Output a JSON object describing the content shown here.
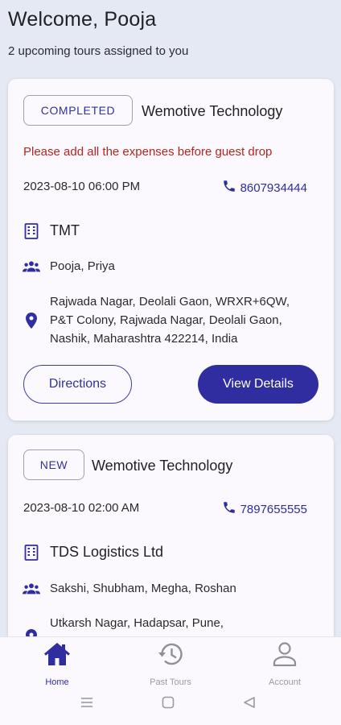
{
  "header": {
    "welcome": "Welcome, Pooja",
    "subtitle": "2 upcoming tours assigned to you"
  },
  "tours": [
    {
      "status": "COMPLETED",
      "company": "Wemotive Technology",
      "alert": "Please add all the expenses before guest drop",
      "datetime": "2023-08-10 06:00 PM",
      "phone": "8607934444",
      "organization": "TMT",
      "guests": "Pooja, Priya",
      "address": "Rajwada Nagar, Deolali Gaon, WRXR+6QW, P&T Colony, Rajwada Nagar, Deolali Gaon, Nashik, Maharashtra 422214, India",
      "directions_label": "Directions",
      "view_details_label": "View Details"
    },
    {
      "status": "NEW",
      "company": "Wemotive Technology",
      "datetime": "2023-08-10 02:00 AM",
      "phone": "7897655555",
      "organization": "TDS Logistics Ltd",
      "guests": "Sakshi, Shubham, Megha, Roshan",
      "address": "Utkarsh Nagar, Hadapsar, Pune,"
    }
  ],
  "nav": {
    "home": "Home",
    "past_tours": "Past Tours",
    "account": "Account"
  },
  "colors": {
    "primary": "#2f2d9f",
    "alert": "#b3261e",
    "background": "#e4e9f3",
    "card": "#fbf9fd"
  },
  "icons": {
    "phone": "phone-icon",
    "organization": "building-icon",
    "guests": "group-icon",
    "address": "location-pin-icon",
    "home": "home-icon",
    "past_tours": "history-icon",
    "account": "person-icon"
  }
}
